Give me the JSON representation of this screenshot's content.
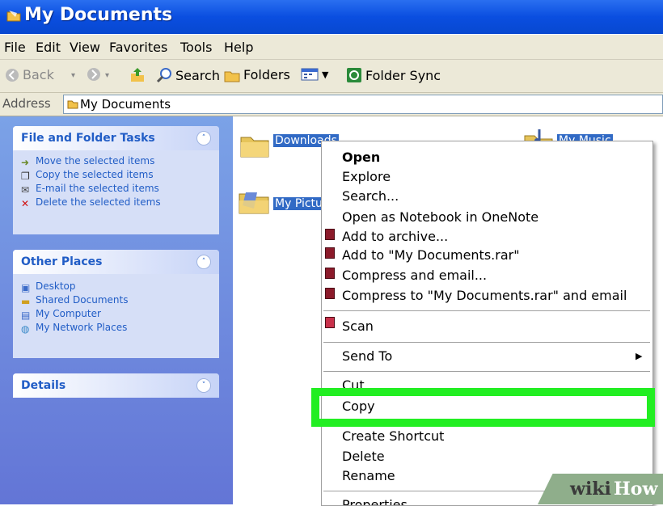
{
  "window": {
    "title": "My Documents"
  },
  "menu": [
    "File",
    "Edit",
    "View",
    "Favorites",
    "Tools",
    "Help"
  ],
  "toolbar": {
    "back": "Back",
    "search": "Search",
    "folders": "Folders",
    "sync": "Folder Sync"
  },
  "address": {
    "label": "Address",
    "value": "My Documents"
  },
  "sidebar": {
    "file_tasks": {
      "title": "File and Folder Tasks",
      "items": [
        "Move the selected items",
        "Copy the selected items",
        "E-mail the selected items",
        "Delete the selected items"
      ]
    },
    "other_places": {
      "title": "Other Places",
      "items": [
        "Desktop",
        "Shared Documents",
        "My Computer",
        "My Network Places"
      ]
    },
    "details": {
      "title": "Details"
    }
  },
  "folders": {
    "downloads": "Downloads",
    "pictures": "My Pictures",
    "music": "My Music"
  },
  "context_menu": {
    "open": "Open",
    "explore": "Explore",
    "search": "Search...",
    "onenote": "Open as Notebook in OneNote",
    "add_archive": "Add to archive...",
    "add_rar": "Add to \"My Documents.rar\"",
    "compress_email": "Compress and email...",
    "compress_rar_email": "Compress to \"My Documents.rar\" and email",
    "scan": "Scan",
    "send_to": "Send To",
    "cut": "Cut",
    "copy": "Copy",
    "create_shortcut": "Create Shortcut",
    "delete": "Delete",
    "rename": "Rename",
    "properties": "Properties"
  },
  "watermark": {
    "part1": "wiki",
    "part2": "How"
  }
}
